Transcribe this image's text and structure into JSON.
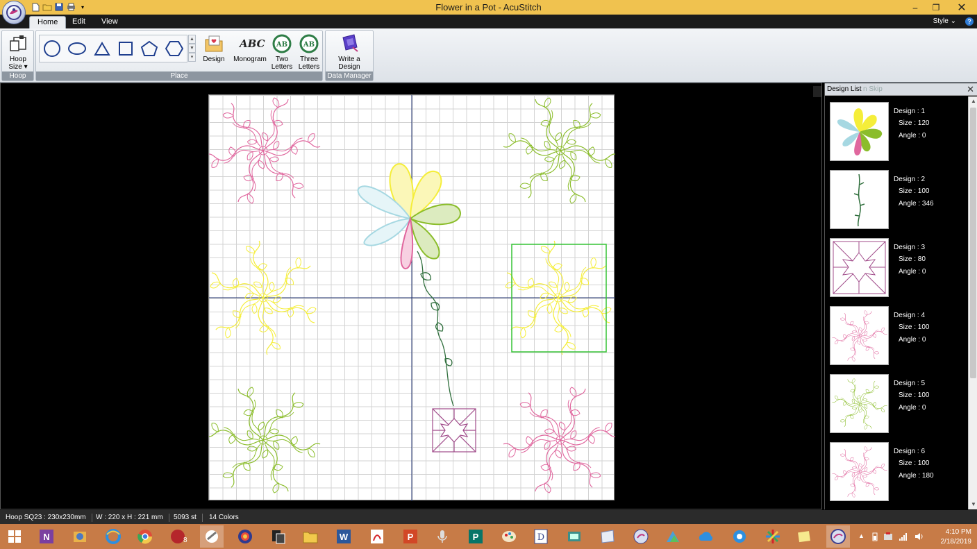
{
  "window": {
    "title": "Flower in a Pot - AcuStitch",
    "minimize": "–",
    "restore": "❐",
    "close": "✕"
  },
  "tabs": [
    "Home",
    "Edit",
    "View"
  ],
  "style_label": "Style",
  "help": "?",
  "ribbon": {
    "hoop_group": {
      "button": "Hoop Size",
      "label": "Hoop"
    },
    "place_group": {
      "label": "Place",
      "buttons": [
        "Design",
        "Monogram",
        "Two Letters",
        "Three Letters"
      ],
      "monogram_glyph": "ABC"
    },
    "data_group": {
      "button": "Write a Design",
      "label": "Data Manager"
    }
  },
  "design_panel": {
    "title": "Design List",
    "ghost_title": "n Skip",
    "close": "✕"
  },
  "designs": [
    {
      "name": "Design : 1",
      "size": "Size : 120",
      "angle": "Angle : 0"
    },
    {
      "name": "Design : 2",
      "size": "Size : 100",
      "angle": "Angle : 346"
    },
    {
      "name": "Design : 3",
      "size": "Size : 80",
      "angle": "Angle : 0"
    },
    {
      "name": "Design : 4",
      "size": "Size : 100",
      "angle": "Angle : 0"
    },
    {
      "name": "Design : 5",
      "size": "Size : 100",
      "angle": "Angle : 0"
    },
    {
      "name": "Design : 6",
      "size": "Size : 100",
      "angle": "Angle : 180"
    }
  ],
  "status": [
    "Hoop SQ23 : 230x230mm",
    "W : 220 x H : 221 mm",
    "5093 st",
    "14 Colors"
  ],
  "taskbar_icons": [
    "windows-start",
    "onenote",
    "app-3",
    "internet-explorer",
    "chrome",
    "pbp-8",
    "acustitch-tools",
    "app-8",
    "app-9",
    "file-explorer",
    "word",
    "acrobat",
    "powerpoint",
    "microphone",
    "publisher",
    "paint",
    "app-17",
    "app-18",
    "app-19",
    "app-20",
    "onedrive",
    "settings",
    "app-23",
    "sticky-notes",
    "acustitch"
  ],
  "taskbar_pbp_badge": "8",
  "clock": {
    "time": "4:10 PM",
    "date": "2/18/2019"
  },
  "colors": {
    "pink": "#e0679e",
    "lime": "#8bbd2b",
    "yellow": "#f5ee3a",
    "cyan": "#a6d8e2",
    "green": "#2f6e3c",
    "purple": "#a04b8a",
    "selection": "#35c335"
  }
}
